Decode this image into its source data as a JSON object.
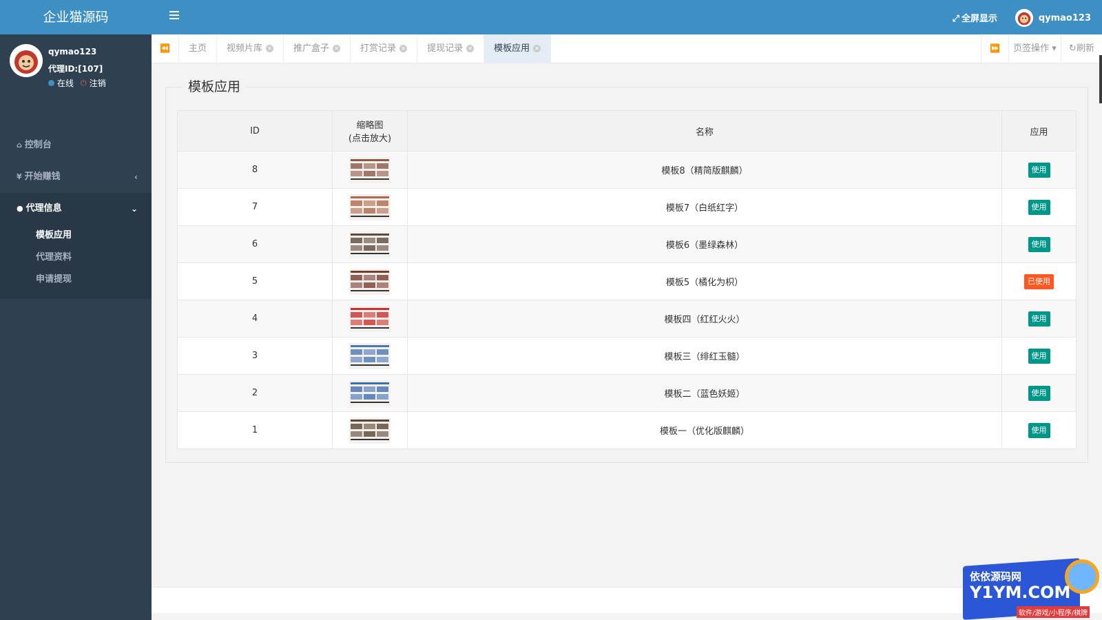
{
  "brand": {
    "title": "企业猫源码"
  },
  "profile": {
    "name": "qymao123",
    "agent_id": "代理ID:[107]",
    "online": "在线",
    "logout": "注销"
  },
  "nav": {
    "dashboard": "控制台",
    "earn": "开始赚钱",
    "agent_info": "代理信息",
    "sub_items": [
      "模板应用",
      "代理资料",
      "申请提现"
    ]
  },
  "topbar": {
    "fullscreen": "全屏显示",
    "user": "qymao123"
  },
  "tabs": {
    "items": [
      "主页",
      "视频片库",
      "推广盒子",
      "打赏记录",
      "提现记录",
      "模板应用"
    ],
    "ops": "页签操作",
    "refresh": "刷新"
  },
  "panel": {
    "title": "模板应用",
    "headers": {
      "id": "ID",
      "thumb": "缩略图",
      "thumb_note": "(点击放大)",
      "name": "名称",
      "apply": "应用"
    },
    "rows": [
      {
        "id": "8",
        "name": "模板8（精简版麒麟）",
        "action": "使用",
        "used": false,
        "thumb_color": "#8a5a44"
      },
      {
        "id": "7",
        "name": "模板7（白纸红字）",
        "action": "使用",
        "used": false,
        "thumb_color": "#b06a4a"
      },
      {
        "id": "6",
        "name": "模板6（墨绿森林）",
        "action": "使用",
        "used": false,
        "thumb_color": "#5b4a3a"
      },
      {
        "id": "5",
        "name": "模板5（橘化为枳）",
        "action": "已使用",
        "used": true,
        "thumb_color": "#7a3b2e"
      },
      {
        "id": "4",
        "name": "模板四（红红火火）",
        "action": "使用",
        "used": false,
        "thumb_color": "#c9302c"
      },
      {
        "id": "3",
        "name": "模板三（绯红玉髓）",
        "action": "使用",
        "used": false,
        "thumb_color": "#4a78b5"
      },
      {
        "id": "2",
        "name": "模板二（蓝色妖姬）",
        "action": "使用",
        "used": false,
        "thumb_color": "#3f6fb0"
      },
      {
        "id": "1",
        "name": "模板一（优化版麒麟）",
        "action": "使用",
        "used": false,
        "thumb_color": "#5a4630"
      }
    ]
  },
  "watermark": {
    "line1": "依依源码网",
    "line2": "Y1YM.COM",
    "line3": "软件/游戏/小程序/棋牌"
  },
  "colors": {
    "sidebar": "#2f4050",
    "topbar": "#3d8fc4",
    "use_button": "#009688",
    "used_button": "#ff5722"
  }
}
